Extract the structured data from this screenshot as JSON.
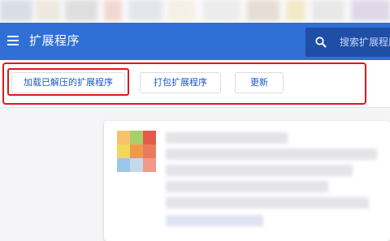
{
  "header": {
    "title": "扩展程序",
    "search_placeholder": "搜索扩展程序"
  },
  "toolbar": {
    "load_unpacked_label": "加载已解压的扩展程序",
    "pack_extension_label": "打包扩展程序",
    "update_label": "更新"
  },
  "colors": {
    "header_blue": "#2f6fd6",
    "search_bg": "#1f4ea6",
    "button_text": "#1a57c8",
    "highlight_red": "#e0161b"
  },
  "icons": [
    "menu-icon",
    "search-icon",
    "extension-icon"
  ]
}
